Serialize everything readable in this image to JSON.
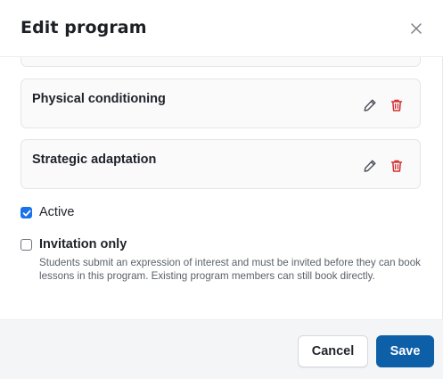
{
  "dialog": {
    "title": "Edit program"
  },
  "program_items": [
    {
      "name": "Physical conditioning"
    },
    {
      "name": "Strategic adaptation"
    }
  ],
  "options": {
    "active": {
      "label": "Active",
      "checked": true
    },
    "invitation_only": {
      "label": "Invitation only",
      "checked": false,
      "help": "Students submit an expression of interest and must be invited before they can book lessons in this program. Existing program members can still book directly."
    }
  },
  "footer": {
    "cancel_label": "Cancel",
    "save_label": "Save"
  },
  "colors": {
    "primary": "#0d5fa8",
    "checkbox_checked": "#1a73e8",
    "delete_icon": "#d32f2f",
    "footer_bg": "#f4f5f7"
  },
  "icons": {
    "close": "close-icon",
    "edit": "pencil-icon",
    "delete": "trash-icon",
    "check": "check-icon"
  }
}
